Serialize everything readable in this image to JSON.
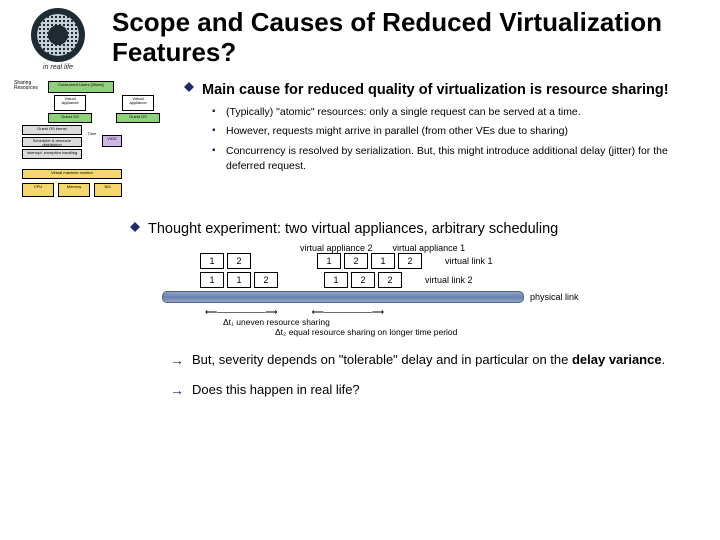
{
  "header": {
    "title": "Scope and Causes of Reduced Virtualization Features?",
    "logo_caption": "in real life"
  },
  "diagram": {
    "label_sharing": "Sharing Resources",
    "label_concurrent": "Concurrent Users (Slices)",
    "va1": "Virtual appliance",
    "va2": "Virtual appliance",
    "guest1": "Guest OS",
    "guest2": "Guest OS",
    "guest_left_1": "Guest OS kernel",
    "guest_left_2": "Scheduler & resource distribution",
    "guest_left_3": "Interrupt, exception handling",
    "time": "Time",
    "vioc": "VIOC",
    "vmm": "Virtual machine monitor",
    "cpu": "CPU",
    "memory": "Memory",
    "nic": "NIC"
  },
  "main": {
    "cause_prefix": "Main cause for reduced quality of virtualization is ",
    "cause_emph": "resource sharing!",
    "sub": [
      "(Typically) \"atomic\" resources: only a single request can be served at a time.",
      "However, requests might arrive in parallel (from other VEs due to sharing)",
      "Concurrency is resolved by serialization. But, this might introduce additional delay (jitter) for the deferred request."
    ]
  },
  "thought": {
    "text": "Thought experiment: two virtual appliances, arbitrary scheduling"
  },
  "chart_data": {
    "type": "table",
    "appliance2_label": "virtual appliance 2",
    "appliance1_label": "virtual appliance 1",
    "row1": {
      "slots": [
        "1",
        "2",
        "1",
        "2",
        "1",
        "2"
      ],
      "label": "virtual link 1"
    },
    "row2": {
      "slots": [
        "1",
        "1",
        "2",
        "1",
        "2",
        "2"
      ],
      "label": "virtual link 2"
    },
    "bar_label": "physical link",
    "bottom_captions": [
      "Δt₁ uneven resource sharing",
      "Δt₂ equal resource sharing on longer time period"
    ]
  },
  "concl": {
    "line1_prefix": "But, severity depends on \"tolerable\" delay and in particular on the ",
    "line1_emph": "delay variance",
    "line1_suffix": ".",
    "line2": "Does this happen in real life?"
  }
}
